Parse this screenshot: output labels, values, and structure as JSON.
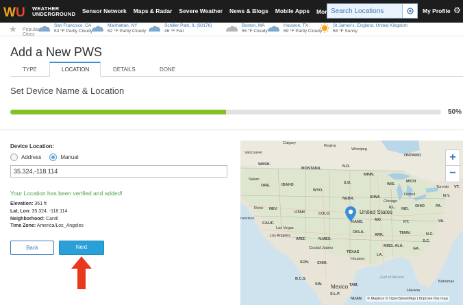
{
  "nav": {
    "logo_line1": "WEATHER",
    "logo_line2": "UNDERGROUND",
    "links": [
      "Sensor Network",
      "Maps & Radar",
      "Severe Weather",
      "News & Blogs",
      "Mobile Apps",
      "More"
    ],
    "search_placeholder": "Search Locations",
    "profile": "My Profile"
  },
  "cities": {
    "popular_label_1": "Popular",
    "popular_label_2": "Cities",
    "items": [
      {
        "name": "San Francisco, CA",
        "cond": "53 °F Partly Cloudy",
        "icon": "partly-cloudy-icon"
      },
      {
        "name": "Manhattan, NY",
        "cond": "62 °F Partly Cloudy",
        "icon": "partly-cloudy-icon"
      },
      {
        "name": "Schiller Park, IL (60176)",
        "cond": "46 °F Fair",
        "icon": "partly-cloudy-icon"
      },
      {
        "name": "Boston, MA",
        "cond": "55 °F Cloudy",
        "icon": "cloudy-icon"
      },
      {
        "name": "Houston, TX",
        "cond": "69 °F Partly Cloudy",
        "icon": "partly-cloudy-icon"
      },
      {
        "name": "St James's, England, United Kingdom",
        "cond": "58 °F Sunny",
        "icon": "sunny-icon"
      }
    ]
  },
  "page": {
    "title": "Add a New PWS",
    "tabs": [
      "TYPE",
      "LOCATION",
      "DETAILS",
      "DONE"
    ],
    "active_tab": "LOCATION",
    "section_title": "Set Device Name & Location",
    "progress_percent": 50,
    "progress_label": "50%"
  },
  "form": {
    "device_location_label": "Device Location:",
    "radio_address": "Address",
    "radio_manual": "Manual",
    "selected": "Manual",
    "coords_value": "35.324,-118.114",
    "verified_msg": "Your Location has been verified and added!",
    "elevation_label": "Elevation:",
    "elevation_value": "361 ft",
    "latlon_label": "Lat, Lon:",
    "latlon_value": "35.324, -118.114",
    "neighborhood_label": "Neighborhood:",
    "neighborhood_value": "Cantil",
    "timezone_label": "Time Zone:",
    "timezone_value": "America/Los_Angeles",
    "back": "Back",
    "next": "Next"
  },
  "map": {
    "attribution": "© Mapbox © OpenStreetMap | Improve this map",
    "zoom_in": "+",
    "zoom_out": "−",
    "labels": {
      "calgary": "Calgary",
      "vancouver": "Vancouver",
      "regina": "Regina",
      "winnipeg": "Winnipeg",
      "wash": "WASH.",
      "montana": "MONTANA",
      "nd": "N.D.",
      "ontario": "ONTARIO",
      "minn": "MINN.",
      "salem": "Salem",
      "ore": "ORE.",
      "idaho": "IDAHO",
      "wyo": "WYO.",
      "sd": "S.D.",
      "wis": "WIS.",
      "mich": "MICH",
      "toronto": "Toronto",
      "vt": "VT.",
      "iowa": "IOWA",
      "nebr": "NEBR.",
      "detroit": "Detroit",
      "chicago": "Chicago",
      "ny": "N.Y.",
      "reno": "Reno",
      "nev": "NEV.",
      "utah": "UTAH",
      "colo": "COLO.",
      "ill": "ILL.",
      "ind": "IND.",
      "ohio": "OHIO",
      "pa": "PA.",
      "francisco": "rancisco",
      "calif": "CALIF.",
      "lasvegas": "Las Vegas",
      "kans": "KANS.",
      "mo": "MO.",
      "ky": "KY.",
      "va": "VA.",
      "losangeles": "Los Angeles",
      "ariz": "ARIZ.",
      "nmex": "N.MEX.",
      "okla": "OKLA.",
      "ark": "ARK.",
      "tenn": "TENN.",
      "nc": "N.C.",
      "sc": "S.C.",
      "ciudadjuarez": "Ciudad Juárez",
      "texas": "TEXAS",
      "missala": "MISS. ALA.",
      "ga": "GA.",
      "son": "SON.",
      "chih": "CHIH.",
      "houston": "Houston",
      "la": "LA.",
      "bcs": "B.C.S.",
      "sin": "SIN.",
      "tam": "TAM.",
      "gulf": "Gulf of Mexico",
      "bahamas": "Bahamas",
      "havana": "Havana",
      "slp": "S.L.P.",
      "nuan": "NUAN",
      "united_states": "United States",
      "mexico": "Mexico"
    }
  }
}
